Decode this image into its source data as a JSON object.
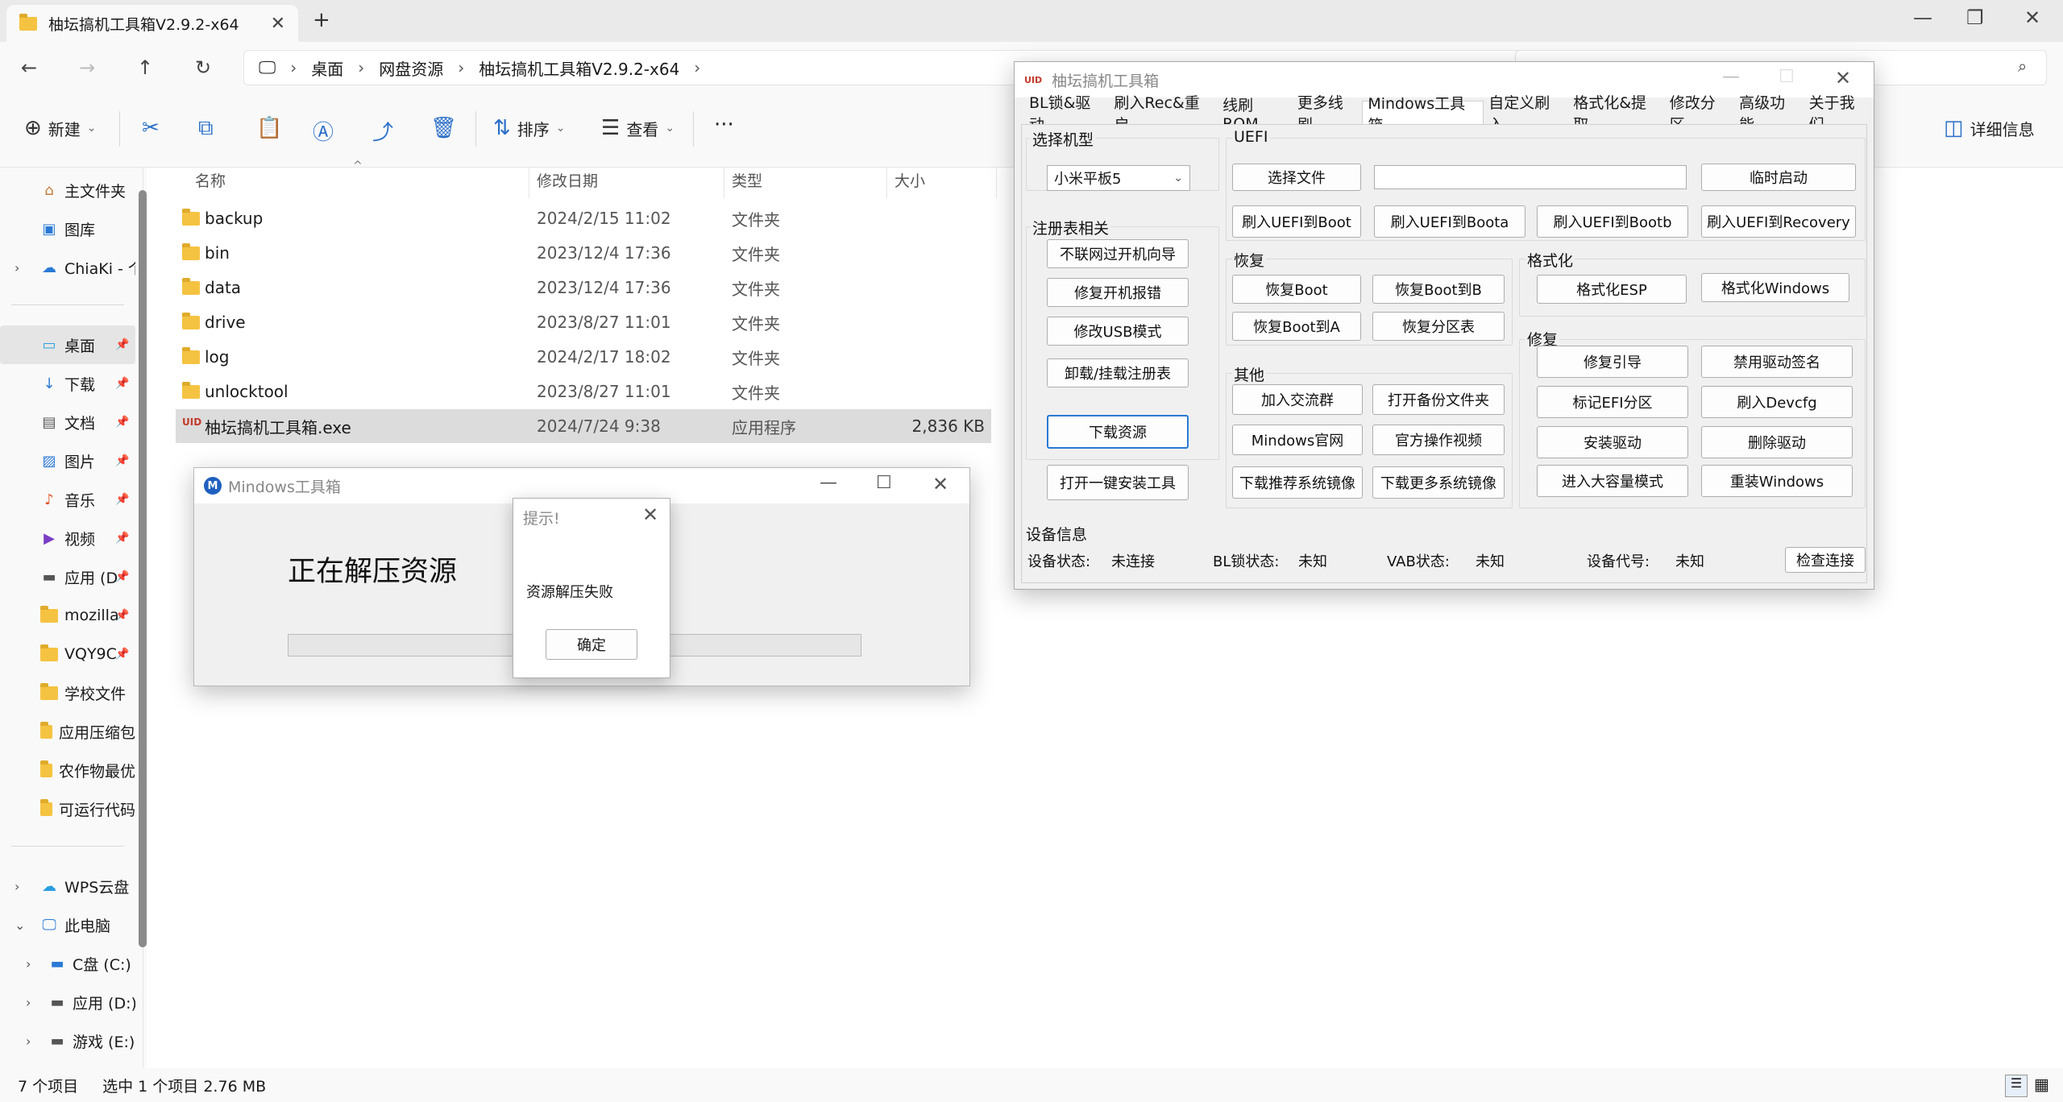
{
  "explorer": {
    "tab_title": "柚坛搞机工具箱V2.9.2-x64",
    "breadcrumb": [
      "桌面",
      "网盘资源",
      "柚坛搞机工具箱V2.9.2-x64"
    ],
    "toolbar": {
      "new": "新建",
      "sort": "排序",
      "view": "查看",
      "details": "详细信息"
    },
    "sidebar": {
      "home": "主文件夹",
      "gallery": "图库",
      "cloud": "ChiaKi - 个",
      "desktop": "桌面",
      "downloads": "下载",
      "documents": "文档",
      "pictures": "图片",
      "music": "音乐",
      "videos": "视频",
      "app_d": "应用 (D",
      "mozilla": "mozilla",
      "vqy": "VQY9C",
      "school": "学校文件",
      "appzip": "应用压缩包",
      "crop": "农作物最优",
      "runnable": "可运行代码",
      "wps": "WPS云盘",
      "thispc": "此电脑",
      "drive_c": "C盘 (C:)",
      "drive_d": "应用 (D:)",
      "drive_e": "游戏 (E:)"
    },
    "columns": {
      "name": "名称",
      "date": "修改日期",
      "type": "类型",
      "size": "大小"
    },
    "files": [
      {
        "name": "backup",
        "date": "2024/2/15 11:02",
        "type": "文件夹",
        "size": ""
      },
      {
        "name": "bin",
        "date": "2023/12/4 17:36",
        "type": "文件夹",
        "size": ""
      },
      {
        "name": "data",
        "date": "2023/12/4 17:36",
        "type": "文件夹",
        "size": ""
      },
      {
        "name": "drive",
        "date": "2023/8/27 11:01",
        "type": "文件夹",
        "size": ""
      },
      {
        "name": "log",
        "date": "2024/2/17 18:02",
        "type": "文件夹",
        "size": ""
      },
      {
        "name": "unlocktool",
        "date": "2023/8/27 11:01",
        "type": "文件夹",
        "size": ""
      },
      {
        "name": "柚坛搞机工具箱.exe",
        "date": "2024/7/24 9:38",
        "type": "应用程序",
        "size": "2,836 KB"
      }
    ],
    "status": {
      "count": "7 个项目",
      "selected": "选中 1 个项目 2.76 MB"
    }
  },
  "mindows": {
    "title": "Mindows工具箱",
    "message": "正在解压资源",
    "progress": 0.0,
    "logo": "M"
  },
  "dialog": {
    "title": "提示!",
    "message": "资源解压失败",
    "ok": "确定"
  },
  "toolbox": {
    "title": "柚坛搞机工具箱",
    "logo": "UID",
    "tabs": [
      "BL锁&驱动",
      "刷入Rec&重启",
      "线刷ROM",
      "更多线刷",
      "Mindows工具箱",
      "自定义刷入",
      "格式化&提取",
      "修改分区",
      "高级功能",
      "关于我们"
    ],
    "model_label": "选择机型",
    "model_value": "小米平板5",
    "reg_label": "注册表相关",
    "reg_buttons": [
      "不联网过开机向导",
      "修复开机报错",
      "修改USB模式",
      "卸载/挂载注册表"
    ],
    "download_res": "下载资源",
    "open_install": "打开一键安装工具",
    "uefi_label": "UEFI",
    "select_file": "选择文件",
    "temp_boot": "临时启动",
    "uefi_buttons": [
      "刷入UEFI到Boot",
      "刷入UEFI到Boota",
      "刷入UEFI到Bootb",
      "刷入UEFI到Recovery"
    ],
    "restore_label": "恢复",
    "restore_buttons": [
      "恢复Boot",
      "恢复Boot到B",
      "恢复Boot到A",
      "恢复分区表"
    ],
    "format_label": "格式化",
    "format_buttons": [
      "格式化ESP",
      "格式化Windows"
    ],
    "other_label": "其他",
    "other_buttons": [
      "加入交流群",
      "打开备份文件夹",
      "Mindows官网",
      "官方操作视频",
      "下载推荐系统镜像",
      "下载更多系统镜像"
    ],
    "repair_label": "修复",
    "repair_buttons": [
      "修复引导",
      "禁用驱动签名",
      "标记EFI分区",
      "刷入Devcfg",
      "安装驱动",
      "删除驱动",
      "进入大容量模式",
      "重装Windows"
    ],
    "device_label": "设备信息",
    "device": {
      "state_k": "设备状态:",
      "state_v": "未连接",
      "bl_k": "BL锁状态:",
      "bl_v": "未知",
      "vab_k": "VAB状态:",
      "vab_v": "未知",
      "code_k": "设备代号:",
      "code_v": "未知"
    },
    "check": "检查连接"
  }
}
